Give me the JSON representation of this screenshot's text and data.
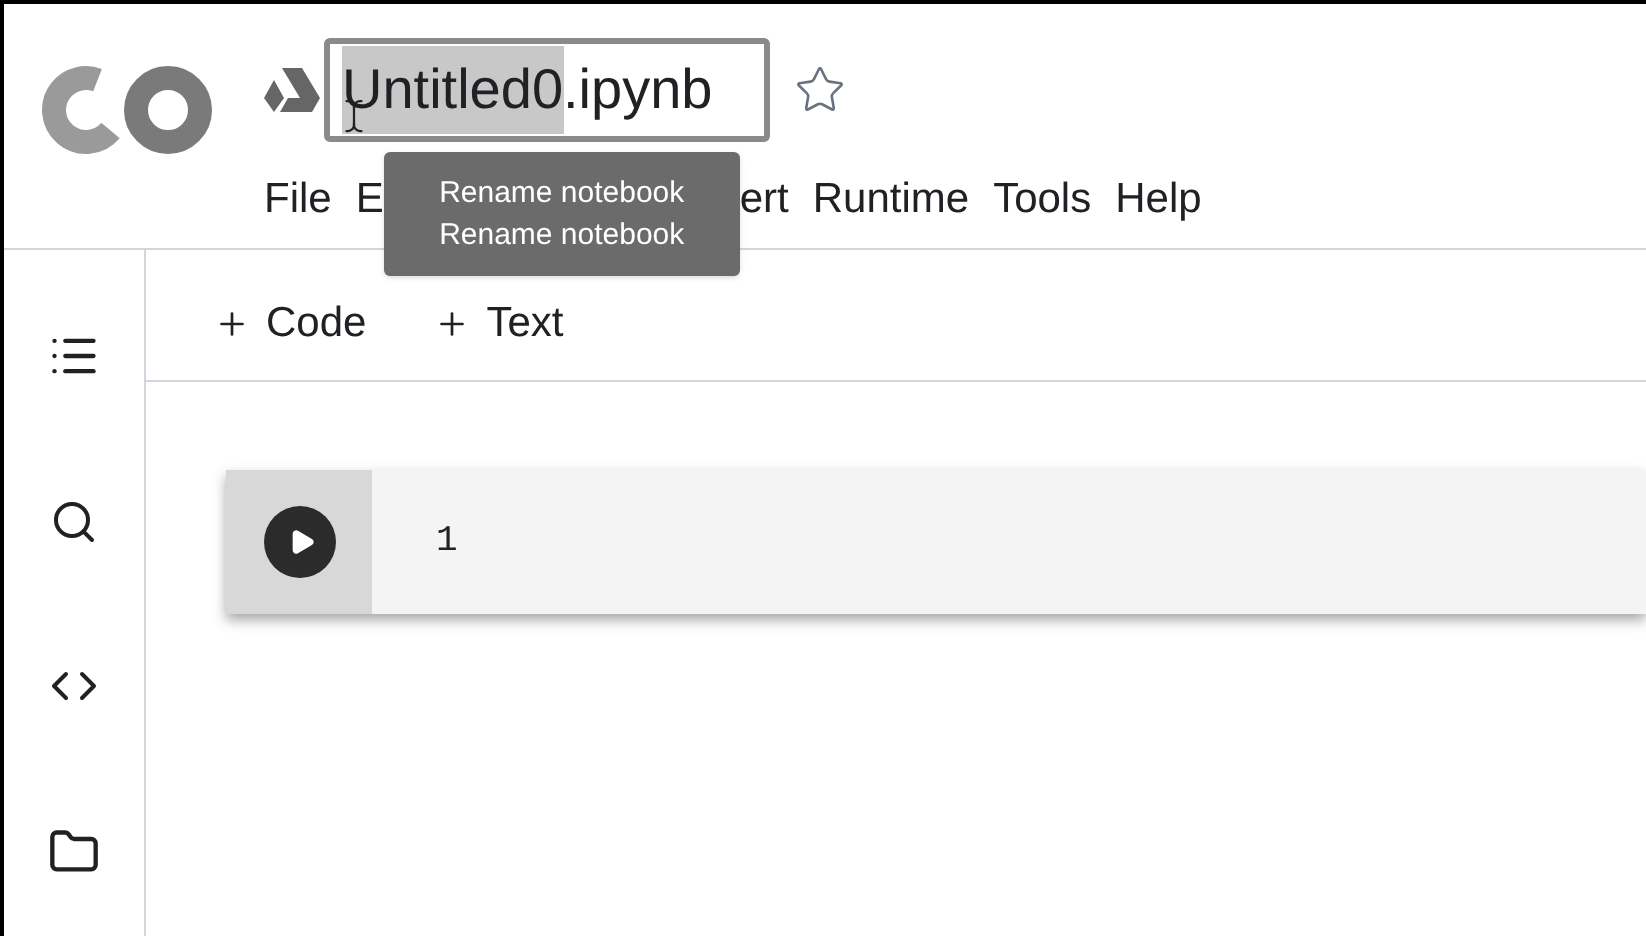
{
  "title": {
    "selected_text": "Untitled0",
    "rest": ".ipynb"
  },
  "menu_left": [
    "File",
    "E"
  ],
  "menu_right": [
    "ert",
    "Runtime",
    "Tools",
    "Help"
  ],
  "tooltip": [
    "Rename notebook",
    "Rename notebook"
  ],
  "toolbar": [
    "Code",
    "Text"
  ],
  "cell": {
    "line_number": "1"
  }
}
